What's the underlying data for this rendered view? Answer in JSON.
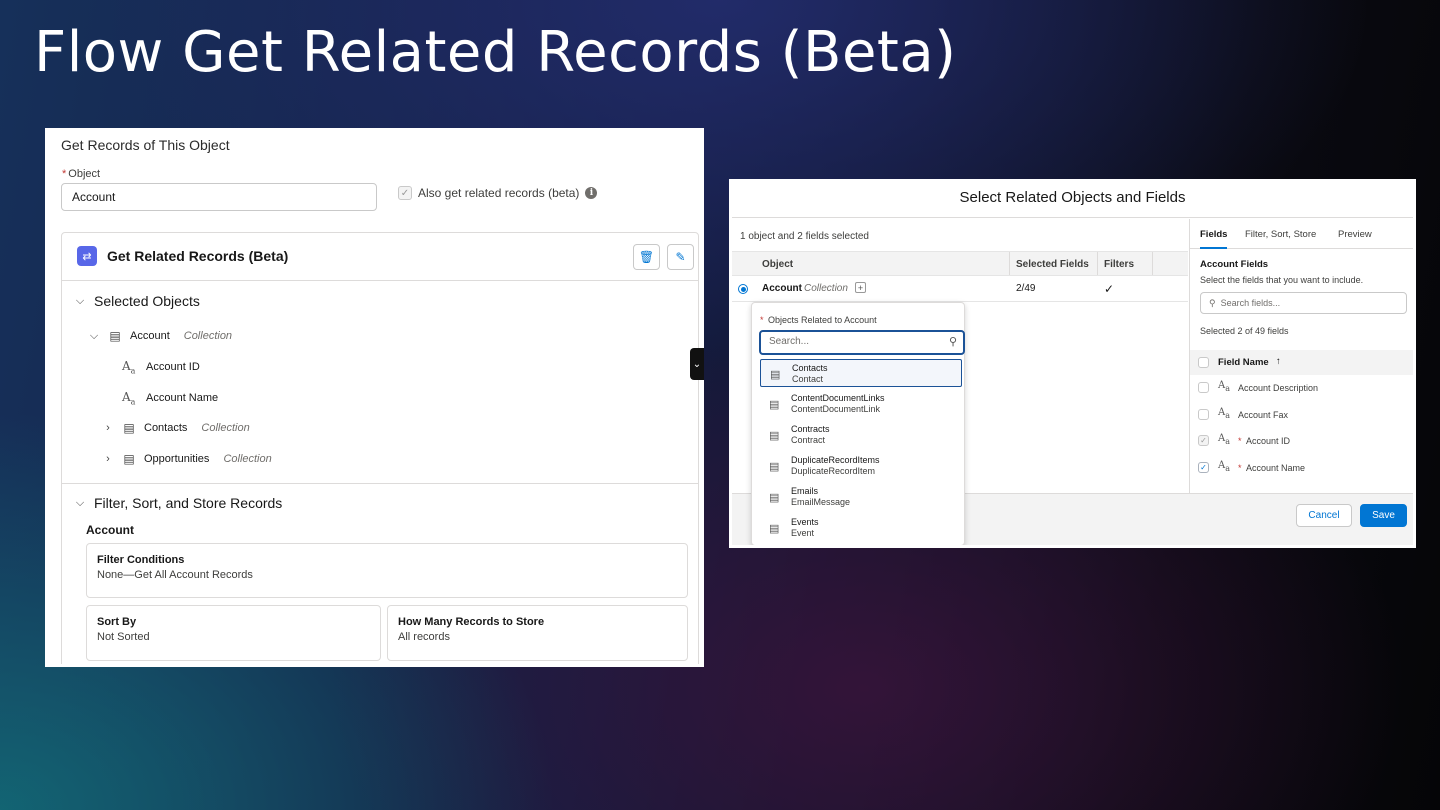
{
  "slide": {
    "title": "Flow Get Related Records (Beta)"
  },
  "left_panel": {
    "header": "Get Records of This Object",
    "object_label": "Object",
    "object_value": "Account",
    "related_checkbox_label": "Also get related records (beta)",
    "card": {
      "title": "Get Related Records (Beta)",
      "selected_objects_label": "Selected Objects",
      "tree": [
        {
          "label": "Account",
          "type": "Collection"
        },
        {
          "label": "Account ID"
        },
        {
          "label": "Account Name"
        },
        {
          "label": "Contacts",
          "type": "Collection"
        },
        {
          "label": "Opportunities",
          "type": "Collection"
        }
      ],
      "filter_section_label": "Filter, Sort, and Store Records",
      "account_label": "Account",
      "filter_conditions_title": "Filter Conditions",
      "filter_conditions_value": "None—Get All Account Records",
      "sort_by_title": "Sort By",
      "sort_by_value": "Not Sorted",
      "how_many_title": "How Many Records to Store",
      "how_many_value": "All records"
    }
  },
  "right_panel": {
    "title": "Select Related Objects and Fields",
    "selection_count": "1 object and 2 fields selected",
    "table_headers": {
      "object": "Object",
      "selected_fields": "Selected Fields",
      "filters": "Filters"
    },
    "row": {
      "object": "Account",
      "type": "Collection",
      "selected_fields": "2/49",
      "filters_check": "✓"
    },
    "dropdown": {
      "label": "Objects Related to Account",
      "search_placeholder": "Search...",
      "items": [
        {
          "name": "Contacts",
          "api": "Contact"
        },
        {
          "name": "ContentDocumentLinks",
          "api": "ContentDocumentLink"
        },
        {
          "name": "Contracts",
          "api": "Contract"
        },
        {
          "name": "DuplicateRecordItems",
          "api": "DuplicateRecordItem"
        },
        {
          "name": "Emails",
          "api": "EmailMessage"
        },
        {
          "name": "Events",
          "api": "Event"
        }
      ]
    },
    "tabs": [
      "Fields",
      "Filter, Sort, Store",
      "Preview"
    ],
    "fields_heading": "Account Fields",
    "fields_help": "Select the fields that you want to include.",
    "fields_search_placeholder": "Search fields...",
    "fields_selected_count": "Selected 2 of 49 fields",
    "field_name_header": "Field Name",
    "fields": [
      {
        "label": "Account Description",
        "required": false
      },
      {
        "label": "Account Fax",
        "required": false
      },
      {
        "label": "Account ID",
        "required": true
      },
      {
        "label": "Account Name",
        "required": true
      }
    ],
    "cancel_label": "Cancel",
    "save_label": "Save"
  },
  "colors": {
    "brand_blue": "#0176d3",
    "required_red": "#c23934",
    "card_icon": "#5867e8"
  }
}
